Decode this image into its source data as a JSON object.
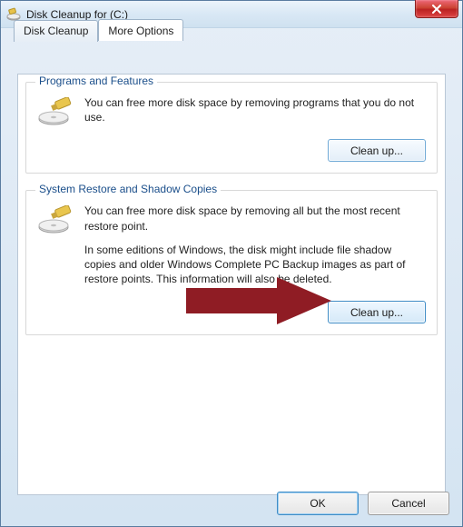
{
  "window": {
    "title": "Disk Cleanup for  (C:)"
  },
  "tabs": {
    "disk_cleanup": "Disk Cleanup",
    "more_options": "More Options"
  },
  "groups": {
    "programs": {
      "title": "Programs and Features",
      "text": "You can free more disk space by removing programs that you do not use.",
      "button": "Clean up..."
    },
    "restore": {
      "title": "System Restore and Shadow Copies",
      "text1": "You can free more disk space by removing all but the most recent restore point.",
      "text2": "In some editions of Windows, the disk might include file shadow copies and older Windows Complete PC Backup images as part of restore points. This information will also be deleted.",
      "button": "Clean up..."
    }
  },
  "dialog": {
    "ok": "OK",
    "cancel": "Cancel"
  },
  "colors": {
    "arrow": "#8f1c24",
    "accent": "#3f8cc6"
  }
}
